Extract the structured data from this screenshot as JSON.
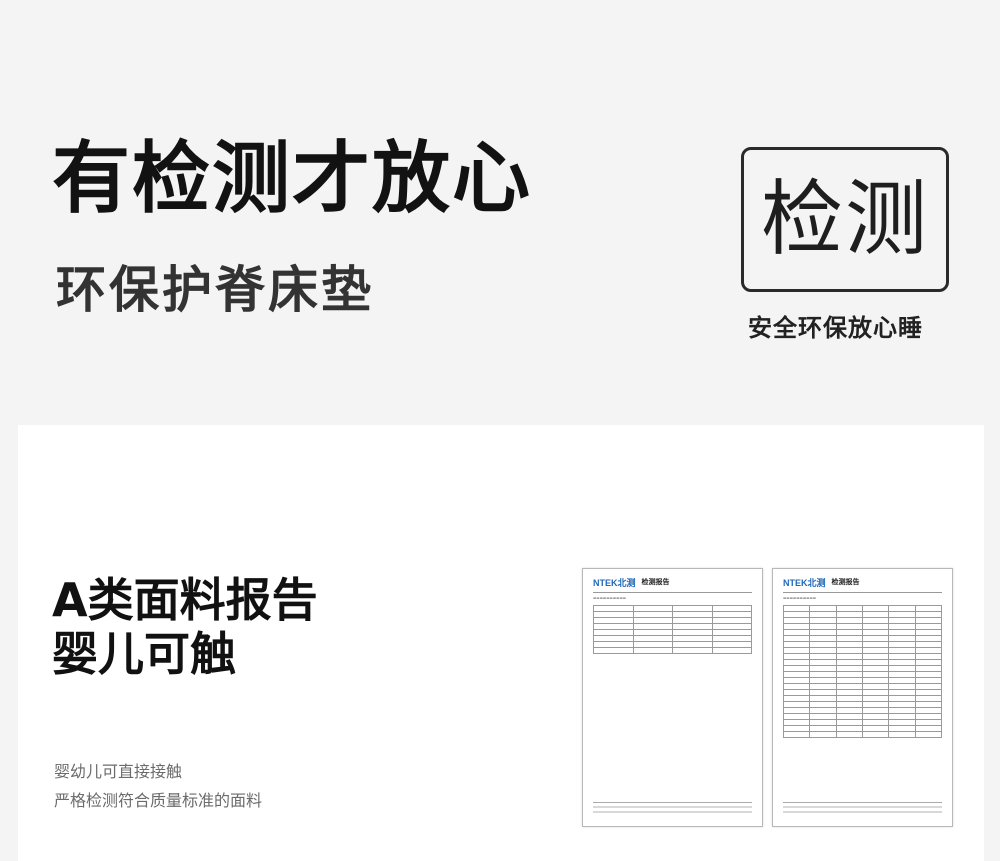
{
  "header": {
    "headline": "有检测才放心",
    "subline": "环保护脊床垫",
    "stamp_text": "检测",
    "stamp_caption": "安全环保放心睡"
  },
  "feature": {
    "title_line1": "A类面料报告",
    "title_line2": "婴儿可触",
    "desc_line1": "婴幼儿可直接接触",
    "desc_line2": "严格检测符合质量标准的面料"
  },
  "reports": [
    {
      "logo": "NTEK北测",
      "title": "检测报告"
    },
    {
      "logo": "NTEK北测",
      "title": "检测报告"
    }
  ]
}
